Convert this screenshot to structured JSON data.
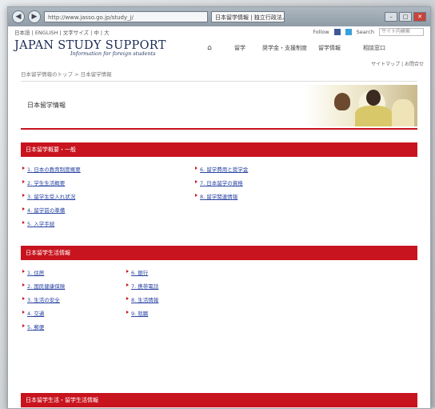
{
  "browser": {
    "address": "http://www.jasso.go.jp/study_j/",
    "tab_title": "日本留学情報 | 独立行政法人..."
  },
  "topbar": {
    "left_text": "日本語 | ENGLISH | 文字サイズ | 中 | 大",
    "follow_label": "Follow",
    "search_label": "Search",
    "search_placeholder": "サイト内検索"
  },
  "logo": {
    "main": "JAPAN STUDY SUPPORT",
    "sub": "Information for foreign students"
  },
  "nav": [
    "ホーム",
    "留学",
    "奨学金・支援制度",
    "留学情報",
    "相談窓口"
  ],
  "utility": "サイトマップ | お問合せ",
  "breadcrumb": "日本留学情報のトップ > 日本留学情報",
  "page": {
    "title": "日本留学情報"
  },
  "section1": {
    "title": "日本留学概要・一般",
    "links": [
      "1. 日本の教育制度概要",
      "2. 学生生活概要",
      "3. 留学生受入れ状況",
      "4. 留学前の準備",
      "5. 入学手続",
      "6. 留学費用と奨学金",
      "7. 日本留学の資格",
      "8. 留学関連情報"
    ]
  },
  "section2": {
    "title": "日本留学生活情報",
    "links": [
      "1. 住居",
      "2. 国民健康保険",
      "3. 生活の安全",
      "4. 交通",
      "5. 郵便",
      "6. 銀行",
      "7. 携帯電話",
      "8. 生活情報",
      "9. 就職"
    ]
  },
  "section3": {
    "title": "日本留学生活・留学生活情報"
  },
  "colors": {
    "accent": "#c8141e",
    "link": "#2a45a3",
    "logo": "#1a2a55"
  }
}
